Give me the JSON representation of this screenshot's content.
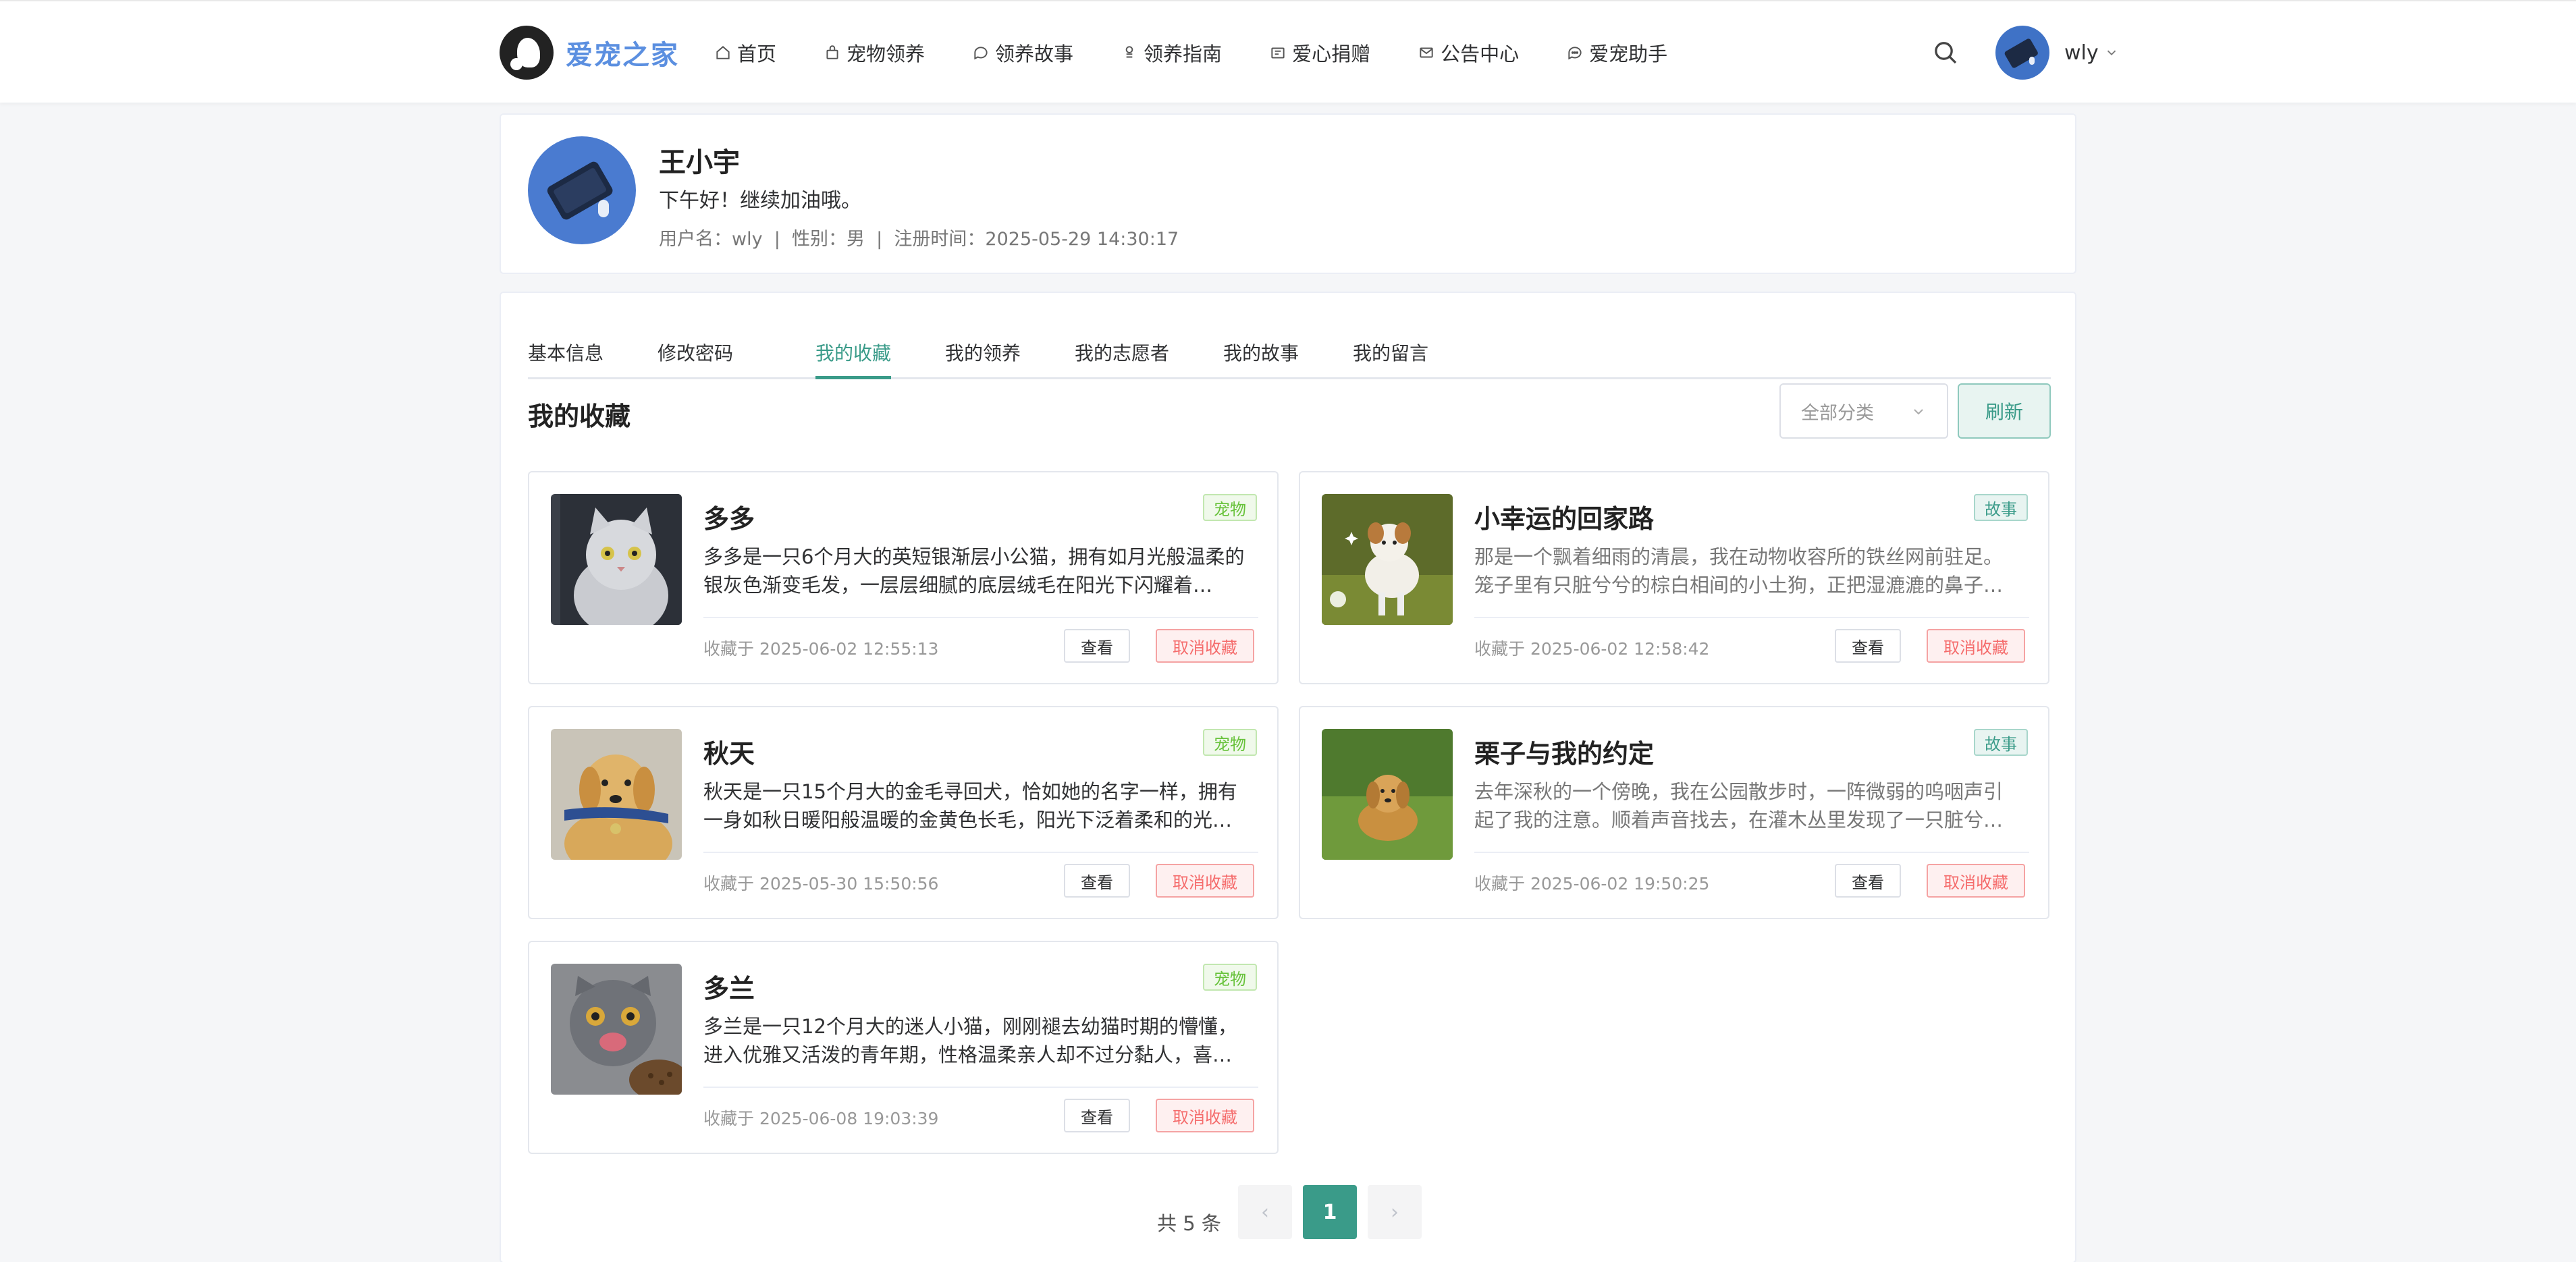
{
  "brand": {
    "name": "爱宠之家"
  },
  "nav": {
    "items": [
      {
        "label": "首页",
        "icon": "home-icon"
      },
      {
        "label": "宠物领养",
        "icon": "bag-icon"
      },
      {
        "label": "领养故事",
        "icon": "chat-icon"
      },
      {
        "label": "领养指南",
        "icon": "guide-icon"
      },
      {
        "label": "爱心捐赠",
        "icon": "gift-icon"
      },
      {
        "label": "公告中心",
        "icon": "mail-icon"
      },
      {
        "label": "爱宠助手",
        "icon": "assistant-icon"
      }
    ],
    "search_icon": "search-icon",
    "user": {
      "name": "wly"
    }
  },
  "profile": {
    "name": "王小宇",
    "greeting": "下午好！继续加油哦。",
    "meta": "用户名：wly  |  性别：男  |  注册时间：2025-05-29 14:30:17"
  },
  "tabs": {
    "items": [
      "基本信息",
      "修改密码",
      "我的收藏",
      "我的领养",
      "我的志愿者",
      "我的故事",
      "我的留言"
    ],
    "active": "我的收藏"
  },
  "favorites": {
    "title": "我的收藏",
    "filter_placeholder": "全部分类",
    "refresh_label": "刷新",
    "view_label": "查看",
    "cancel_label": "取消收藏",
    "items": [
      {
        "title": "多多",
        "tag": "宠物",
        "desc": "多多是一只6个月大的英短银渐层小公猫，拥有如月光般温柔的银灰色渐变毛发，一层层细腻的底层绒毛在阳光下闪耀着…",
        "date": "收藏于 2025-06-02 12:55:13",
        "image": "gray-kitten"
      },
      {
        "title": "小幸运的回家路",
        "tag": "故事",
        "desc": "那是一个飘着细雨的清晨，我在动物收容所的铁丝网前驻足。笼子里有只脏兮兮的棕白相间的小土狗，正把湿漉漉的鼻子贴在铁栅…",
        "date": "收藏于 2025-06-02 12:58:42",
        "image": "running-puppy"
      },
      {
        "title": "秋天",
        "tag": "宠物",
        "desc": "秋天是一只15个月大的金毛寻回犬，恰如她的名字一样，拥有一身如秋日暖阳般温暖的金黄色长毛，阳光下泛着柔和的光…",
        "date": "收藏于 2025-05-30 15:50:56",
        "image": "golden-retriever"
      },
      {
        "title": "栗子与我的约定",
        "tag": "故事",
        "desc": "去年深秋的一个傍晚，我在公园散步时，一阵微弱的呜咽声引起了我的注意。顺着声音找去，在灌木丛里发现了一只脏兮兮的小金…",
        "date": "收藏于 2025-06-02 19:50:25",
        "image": "dog-on-grass"
      },
      {
        "title": "多兰",
        "tag": "宠物",
        "desc": "多兰是一只12个月大的迷人小猫，刚刚褪去幼猫时期的懵懂，进入优雅又活泼的青年期，性格温柔亲人却不过分黏人，喜…",
        "date": "收藏于 2025-06-08 19:03:39",
        "image": "scottish-fold-cat"
      }
    ]
  },
  "pagination": {
    "total_label": "共 5 条",
    "current": "1",
    "prev": "‹",
    "next": "›"
  },
  "colors": {
    "primary": "#3a9b89",
    "brand": "#5b8fe0",
    "danger": "#f56c6c",
    "pet_tag": "#67c23a"
  }
}
